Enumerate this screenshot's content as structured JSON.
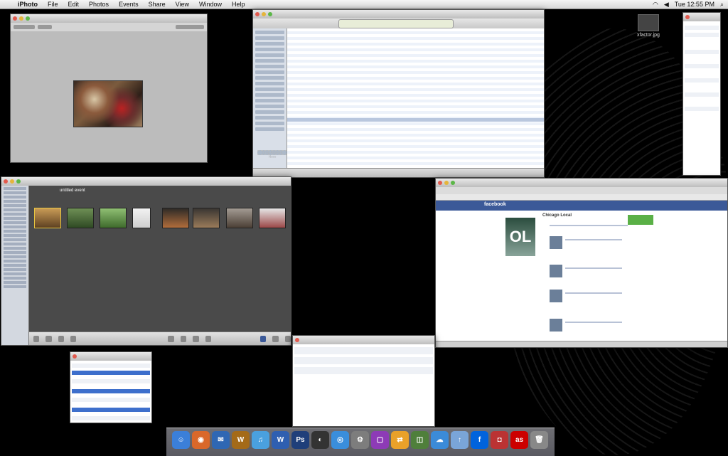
{
  "menubar": {
    "apple": "",
    "app_name": "iPhoto",
    "menus": [
      "File",
      "Edit",
      "Photos",
      "Events",
      "Share",
      "View",
      "Window",
      "Help"
    ],
    "clock": "Tue 12:55 PM"
  },
  "desktop": {
    "icon_label": "xfactor.jpg"
  },
  "windows": {
    "iphoto_event_title": "untitled event",
    "facebook_profile_name": "Chicago Local",
    "facebook_logo": "facebook",
    "facebook_pic_text": "OL",
    "itunes_art_placeholder": "Drop Artwork Here"
  },
  "dock": {
    "apps": [
      {
        "name": "finder",
        "color": "#3b7fd8",
        "glyph": "☺"
      },
      {
        "name": "firefox",
        "color": "#d9682a",
        "glyph": "◉"
      },
      {
        "name": "thunderbird",
        "color": "#2f67b3",
        "glyph": "✉"
      },
      {
        "name": "world-of-warcraft",
        "color": "#a46a18",
        "glyph": "W"
      },
      {
        "name": "itunes",
        "color": "#4aa0de",
        "glyph": "♫"
      },
      {
        "name": "word",
        "color": "#2f5fb0",
        "glyph": "W"
      },
      {
        "name": "photoshop",
        "color": "#1f3f7a",
        "glyph": "Ps"
      },
      {
        "name": "adium",
        "color": "#333",
        "glyph": "◐"
      },
      {
        "name": "safari",
        "color": "#3a8edb",
        "glyph": "◎"
      },
      {
        "name": "system-prefs",
        "color": "#7d7d7d",
        "glyph": "⚙"
      },
      {
        "name": "textmate",
        "color": "#8d3bb6",
        "glyph": "▢"
      },
      {
        "name": "transmit",
        "color": "#e9a12a",
        "glyph": "⇄"
      },
      {
        "name": "iphoto",
        "color": "#4f7f3b",
        "glyph": "◫"
      },
      {
        "name": "ichat",
        "color": "#3b8bd8",
        "glyph": "☁"
      },
      {
        "name": "upload",
        "color": "#7aa5d8",
        "glyph": "↑"
      },
      {
        "name": "flickr",
        "color": "#0063dc",
        "glyph": "f"
      },
      {
        "name": "photo-booth",
        "color": "#b33",
        "glyph": "◘"
      },
      {
        "name": "lastfm",
        "color": "#c00",
        "glyph": "as"
      },
      {
        "name": "trash",
        "color": "#888",
        "glyph": "🗑"
      }
    ]
  }
}
